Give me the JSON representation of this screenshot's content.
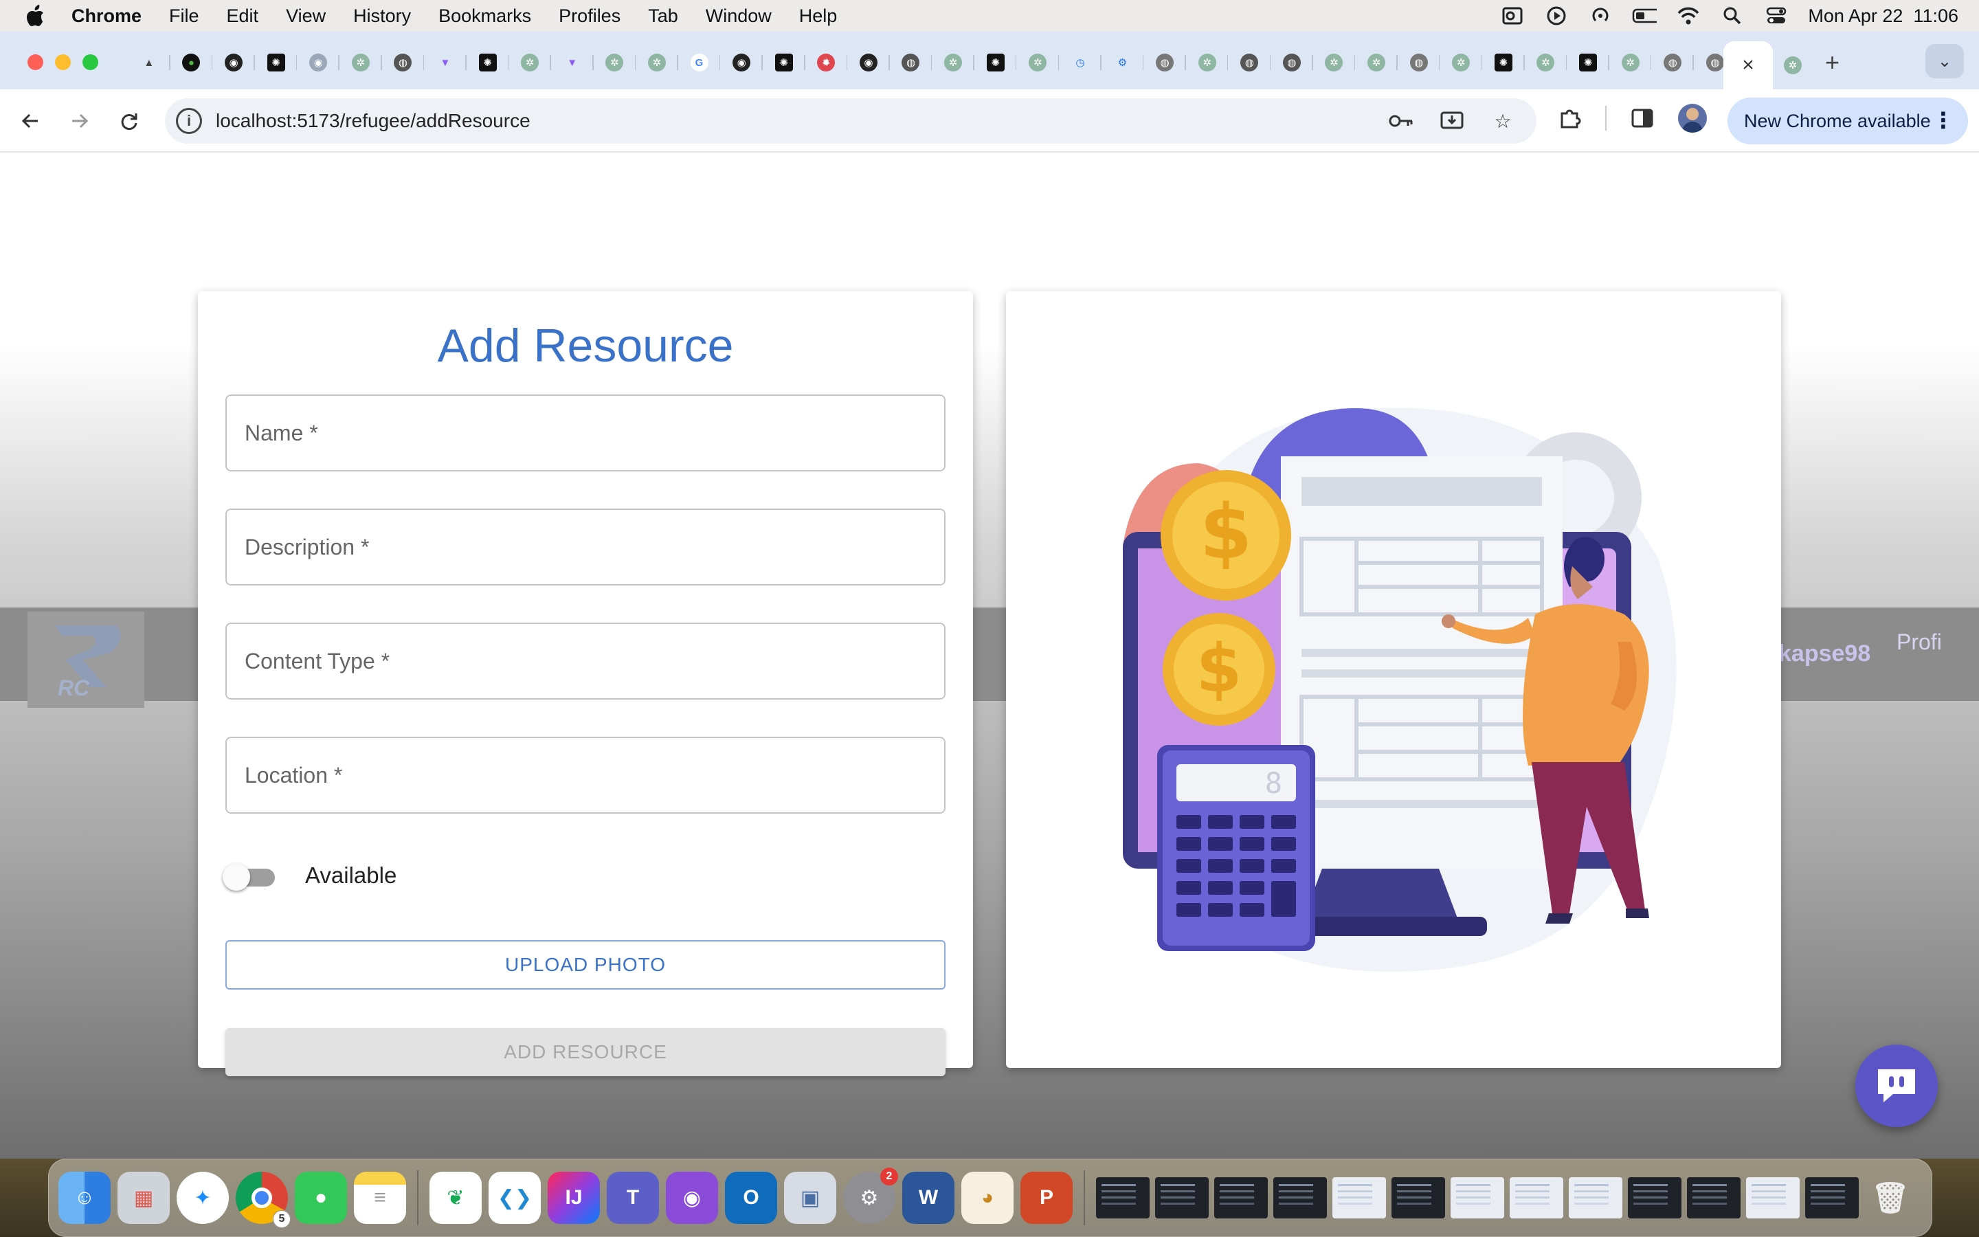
{
  "menubar": {
    "app_name": "Chrome",
    "items": [
      "File",
      "Edit",
      "View",
      "History",
      "Bookmarks",
      "Profiles",
      "Tab",
      "Window",
      "Help"
    ],
    "clock": "Mon Apr 22  11:06"
  },
  "browser": {
    "url": "localhost:5173/refugee/addResource",
    "update_label": "New Chrome available",
    "active_tab_close": "×",
    "new_tab": "+"
  },
  "form": {
    "title": "Add Resource",
    "fields": {
      "name_placeholder": "Name *",
      "description_placeholder": "Description *",
      "content_type_placeholder": "Content Type *",
      "location_placeholder": "Location *"
    },
    "available_label": "Available",
    "available_on": false,
    "upload_label": "UPLOAD PHOTO",
    "submit_label": "ADD RESOURCE"
  },
  "background_nav": {
    "username_partial": "kapse98",
    "profile_alt_partial": "Profi"
  },
  "illustration": {
    "calculator_display": "8"
  },
  "dock": {
    "chrome_badge": "5",
    "settings_badge": "2"
  },
  "colors": {
    "accent": "#3a71c9",
    "chat_fab": "#5c55c8",
    "tab_strip": "#dce6f4"
  }
}
